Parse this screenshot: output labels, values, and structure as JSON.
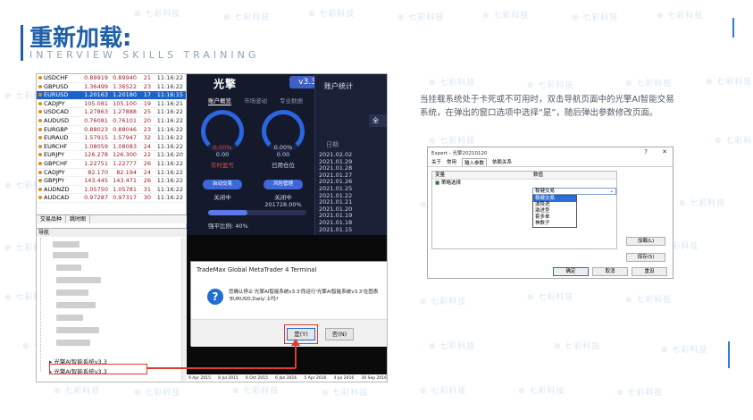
{
  "header": {
    "title": "重新加载:",
    "subtitle": "INTERVIEW SKILLS TRAINING"
  },
  "watermark": "七彩科技",
  "quotes": {
    "rows": [
      {
        "symbol": "USDCHF",
        "bid": "0.89919",
        "ask": "0.89940",
        "spread": "21",
        "time": "11:16:22"
      },
      {
        "symbol": "GBPUSD",
        "bid": "1.36499",
        "ask": "1.36522",
        "spread": "23",
        "time": "11:16:22"
      },
      {
        "symbol": "EURUSD",
        "bid": "1.20163",
        "ask": "1.20180",
        "spread": "17",
        "time": "11:16:15",
        "selected": true
      },
      {
        "symbol": "CADJPY",
        "bid": "105.081",
        "ask": "105.100",
        "spread": "19",
        "time": "11:16:21"
      },
      {
        "symbol": "USDCAD",
        "bid": "1.27863",
        "ask": "1.27888",
        "spread": "25",
        "time": "11:16:22"
      },
      {
        "symbol": "AUDUSD",
        "bid": "0.76081",
        "ask": "0.76101",
        "spread": "20",
        "time": "11:16:22"
      },
      {
        "symbol": "EURGBP",
        "bid": "0.88023",
        "ask": "0.88046",
        "spread": "23",
        "time": "11:16:22"
      },
      {
        "symbol": "EURAUD",
        "bid": "1.57915",
        "ask": "1.57947",
        "spread": "32",
        "time": "11:16:22"
      },
      {
        "symbol": "EURCHF",
        "bid": "1.08059",
        "ask": "1.08083",
        "spread": "24",
        "time": "11:16:22"
      },
      {
        "symbol": "EURJPY",
        "bid": "126.278",
        "ask": "126.300",
        "spread": "22",
        "time": "11:16:20"
      },
      {
        "symbol": "GBPCHF",
        "bid": "1.22751",
        "ask": "1.22777",
        "spread": "26",
        "time": "11:16:22"
      },
      {
        "symbol": "CADJPY",
        "bid": "82.170",
        "ask": "82.194",
        "spread": "24",
        "time": "11:16:22"
      },
      {
        "symbol": "GBPJPY",
        "bid": "143.445",
        "ask": "143.471",
        "spread": "26",
        "time": "11:16:22"
      },
      {
        "symbol": "AUDNZD",
        "bid": "1.05750",
        "ask": "1.05781",
        "spread": "31",
        "time": "11:16:22"
      },
      {
        "symbol": "AUDCAD",
        "bid": "0.97287",
        "ask": "0.97317",
        "spread": "30",
        "time": "11:16:22"
      }
    ],
    "tabs": [
      "交易品种",
      "跳时图"
    ]
  },
  "navigator": {
    "title": "导航",
    "ea_items": [
      "光擎AI智能系统v3.3",
      "光擎AI智能系统v3.3"
    ]
  },
  "app": {
    "name": "光擎",
    "version": "v3.3",
    "tabs": [
      "账户概览",
      "市场波动",
      "专业数据"
    ],
    "gauge_left": {
      "pct": "0.00%",
      "value": "0.00",
      "label": "实时盈亏"
    },
    "gauge_right": {
      "pct": "0.00%",
      "value": "0.00",
      "label": "已用仓位"
    },
    "btn_left": "自动交易",
    "btn_right": "风险管理",
    "status_left": "关闭中",
    "status_right": "关闭中",
    "ratio_value": "201728.00%",
    "ratio_label": "强平比例:  40%",
    "progress": 0.4,
    "account_title": "账户统计",
    "account_btn": "全",
    "date_header": "日期",
    "dates": [
      "2021.02.02",
      "2021.01.29",
      "2021.01.28",
      "2021.01.27",
      "2021.01.26",
      "2021.01.25",
      "2021.01.22",
      "2021.01.21",
      "2021.01.20",
      "2021.01.19",
      "2021.01.18",
      "2021.01.15"
    ]
  },
  "chart_axis": [
    "9 Apr 2015",
    "8 Jul 2015",
    "6 Oct 2015",
    "6 Jan 2016",
    "5 Apr 2016",
    "4 Jul 2016",
    "30 Sep 2016"
  ],
  "dialog": {
    "title": "TradeMax Global MetaTrader 4 Terminal",
    "message": "您确认停止'光擎AI智能系统v3.3'而运行'光擎AI智能系统v3.3'在图表 'EURUSD,Daily'上吗?",
    "yes": "是(Y)",
    "no": "否(N)"
  },
  "description": "当挂载系统处于卡死或不可用时，双击导航页面中的光擎AI智能交易系统，在弹出的窗口选项中选择“是”，随后弹出参数修改页面。",
  "expert": {
    "title": "Expert - 光擎20210120",
    "help": "?",
    "close": "✕",
    "tabs": [
      "关于",
      "常用",
      "输入参数",
      "依赖关系"
    ],
    "col_var": "变量",
    "col_val": "数值",
    "row_var": "策略选择",
    "combo_value": "稳健交易",
    "options": [
      "稳健交易",
      "波段进",
      "激进型",
      "套多单",
      "神数子"
    ],
    "btn_load": "加载(L)",
    "btn_save": "保存(S)",
    "btn_ok": "确定",
    "btn_cancel": "取消",
    "btn_reset": "重设"
  },
  "colors": {
    "brand": "#1f5fa8",
    "highlight_red": "#e23a2f",
    "selected_row": "#1d62c9"
  }
}
